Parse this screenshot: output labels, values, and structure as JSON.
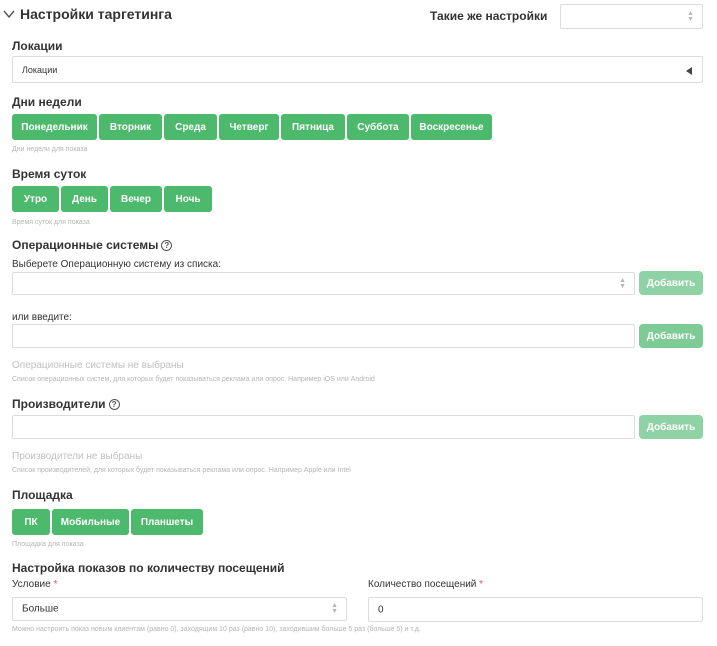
{
  "header": {
    "title": "Настройки таргетинга",
    "same_settings_label": "Такие же настройки",
    "same_settings_value": ""
  },
  "locations": {
    "label": "Локации",
    "select_value": "Локации"
  },
  "weekdays": {
    "label": "Дни недели",
    "days": [
      "Понедельник",
      "Вторник",
      "Среда",
      "Четверг",
      "Пятница",
      "Суббота",
      "Воскресенье"
    ],
    "hint": "Дни недели для показа"
  },
  "daytime": {
    "label": "Время суток",
    "times": [
      "Утро",
      "День",
      "Вечер",
      "Ночь"
    ],
    "hint": "Время суток для показа"
  },
  "os": {
    "label": "Операционные системы",
    "select_label": "Выберете Операционную систему из списка:",
    "select_value": "",
    "add_label": "Добавить",
    "or_label": "или введите:",
    "input_value": "",
    "add2_label": "Добавить",
    "empty_text": "Операционные системы не выбраны",
    "hint": "Список операционных систем, для которых будет показываться реклама или опрос. Например iOS или Android"
  },
  "vendors": {
    "label": "Производители",
    "input_value": "",
    "add_label": "Добавить",
    "empty_text": "Производители не выбраны",
    "hint": "Список производителей, для которых будет показываться реклама или опрос. Например Apple или Intel"
  },
  "platform": {
    "label": "Площадка",
    "options": [
      "ПК",
      "Мобильные",
      "Планшеты"
    ],
    "hint": "Площадка для показа"
  },
  "visits": {
    "label": "Настройка показов по количеству посещений",
    "condition_label": "Условие",
    "condition_value": "Больше",
    "count_label": "Количество посещений",
    "count_value": "0",
    "required_mark": "*",
    "hint": "Можно настроить показ новым клиентам (равно 0), заходящим 10 раз (равно 10), заходившим больше 5 раз (больше 5) и т.д."
  },
  "colors": {
    "accent": "#4db96c",
    "accent_light": "#8fd2a5",
    "required": "#e05252"
  },
  "icons": [
    "chevron-down-icon",
    "help-icon",
    "sort-arrows-icon",
    "caret-left-icon"
  ]
}
